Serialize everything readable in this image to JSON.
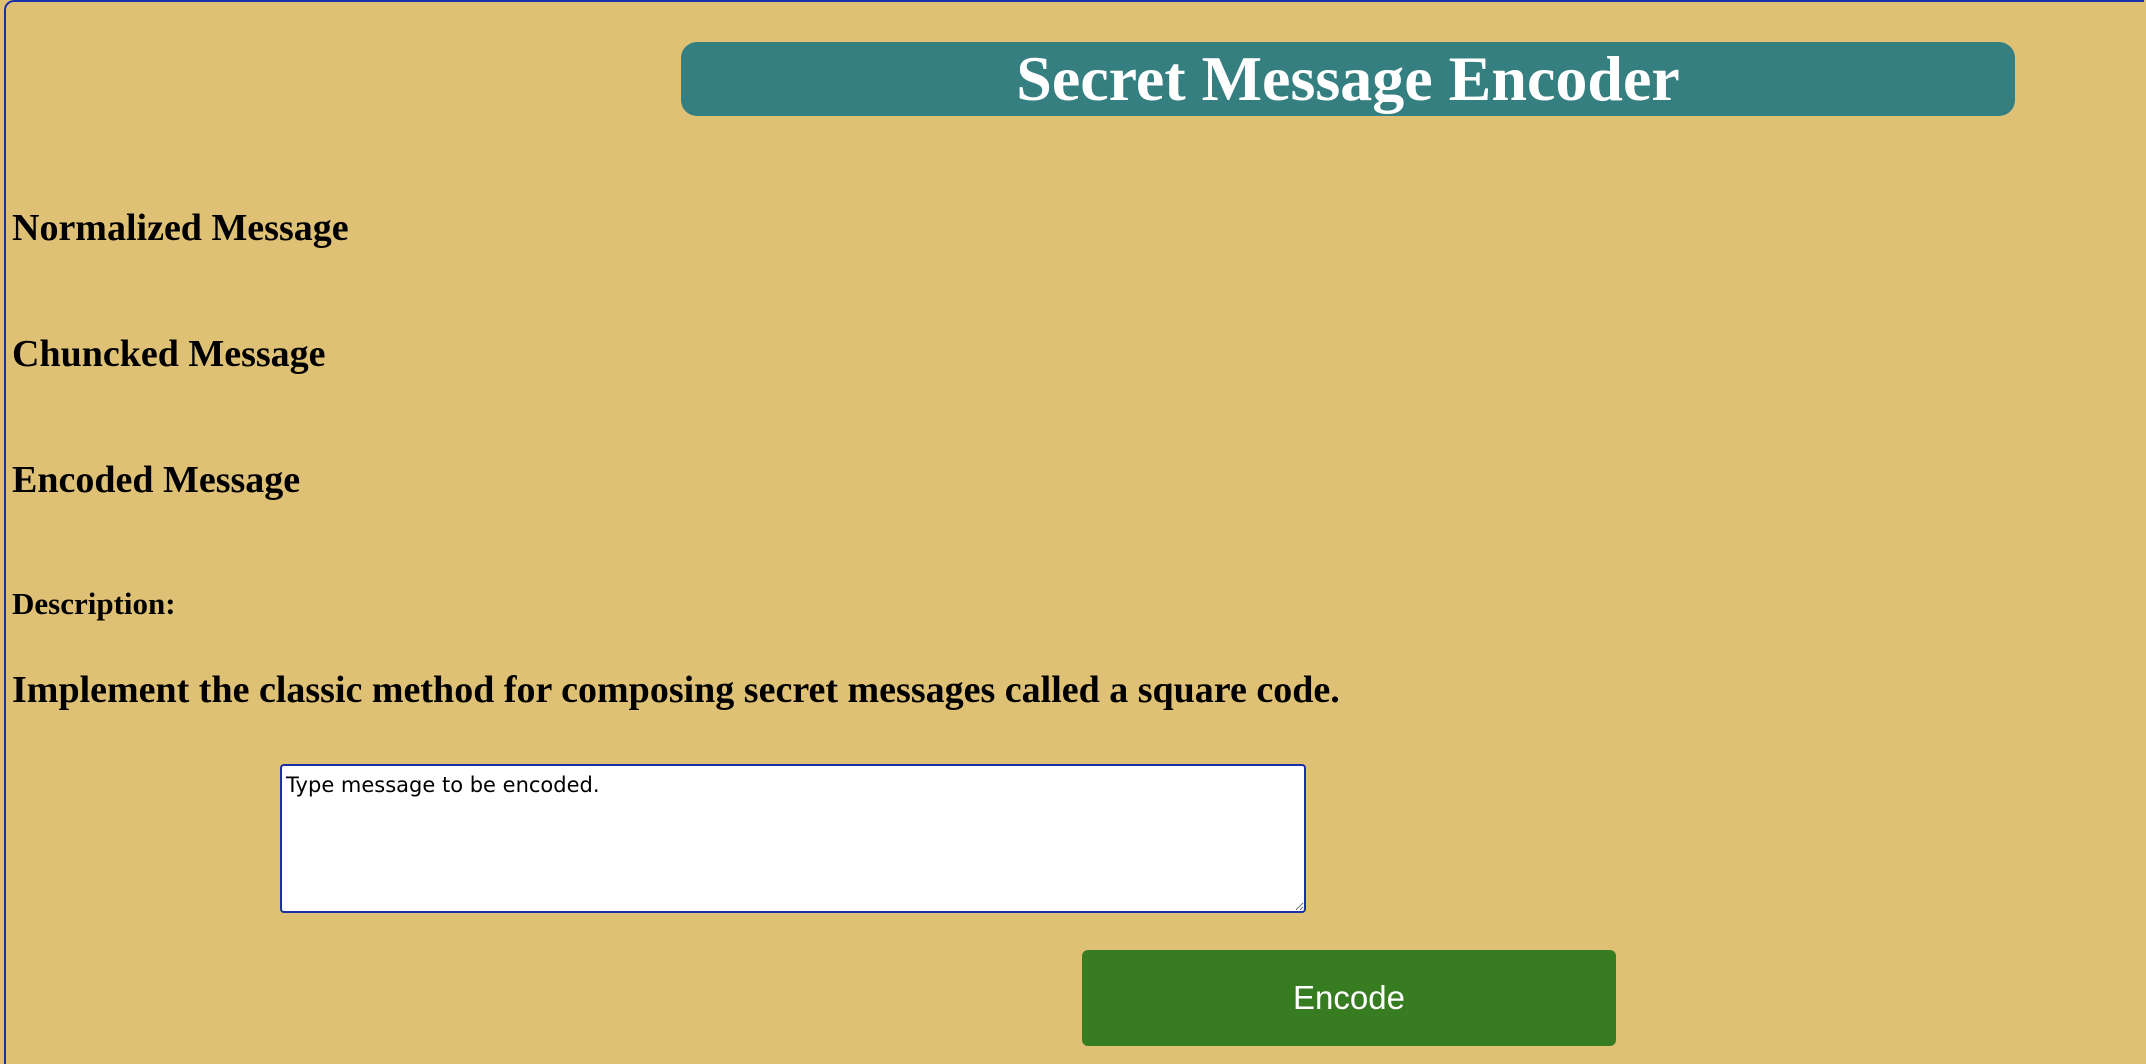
{
  "header": {
    "title": "Secret Message Encoder"
  },
  "sections": {
    "normalized_heading": "Normalized Message",
    "chunked_heading": "Chuncked Message",
    "encoded_heading": "Encoded Message"
  },
  "description": {
    "label": "Description:",
    "text": "Implement the classic method for composing secret messages called a square code."
  },
  "input": {
    "placeholder": "Type message to be encoded.",
    "value": ""
  },
  "actions": {
    "encode_label": "Encode"
  },
  "colors": {
    "background": "#dfc176",
    "title_bar": "#357f81",
    "button": "#387c22",
    "focus_border": "#1a2fa8"
  }
}
